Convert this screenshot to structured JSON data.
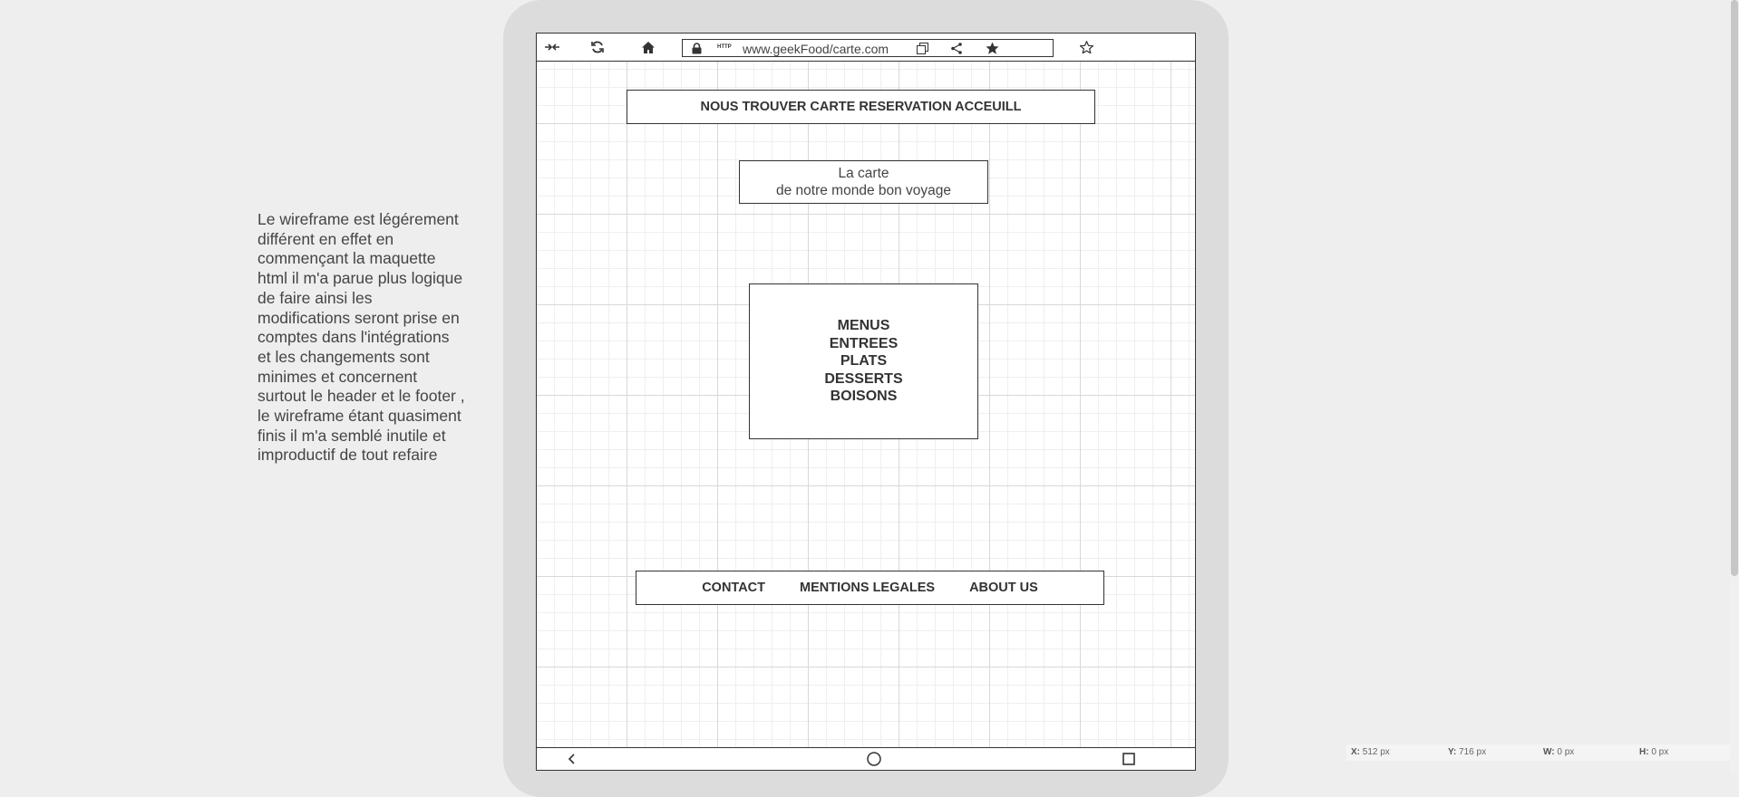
{
  "note": {
    "text": "Le wireframe est légérement\ndifférent en effet en\ncommençant la maquette\nhtml il m'a parue plus logique\nde faire ainsi les\nmodifications seront prise en\ncomptes dans l'intégrations\net les changements sont\nminimes et concernent\nsurtout le header et le footer ,\nle wireframe étant quasiment\nfinis il m'a semblé inutile et\nimproductif de tout refaire"
  },
  "browser": {
    "url": "www.geekFood/carte.com",
    "http_tag": "HTTP",
    "icons": [
      "collapse-icon",
      "refresh-icon",
      "home-icon",
      "lock-icon",
      "copy-icon",
      "share-icon",
      "star-filled-icon",
      "star-outline-icon"
    ]
  },
  "header": {
    "nav_text": "NOUS TROUVER CARTE RESERVATION ACCEUILL"
  },
  "title": {
    "line1": "La carte",
    "line2": "de notre monde bon voyage"
  },
  "menu": {
    "items": [
      "MENUS",
      "ENTREES",
      "PLATS",
      "DESSERTS",
      "BOISONS"
    ]
  },
  "footer": {
    "links": [
      "CONTACT",
      "MENTIONS LEGALES",
      "ABOUT US"
    ]
  },
  "android_nav": {
    "icons": [
      "back-icon",
      "home-circle-icon",
      "recents-square-icon"
    ]
  },
  "status_bar": {
    "x_label": "X:",
    "x_value": "512 px",
    "y_label": "Y:",
    "y_value": "716 px",
    "w_label": "W:",
    "w_value": "0 px",
    "h_label": "H:",
    "h_value": "0 px"
  }
}
